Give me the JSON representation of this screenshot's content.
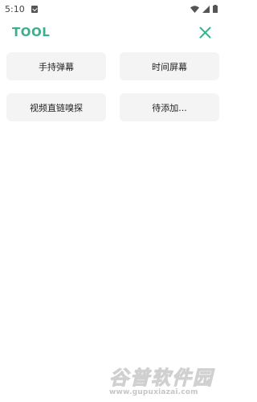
{
  "status_bar": {
    "time": "5:10",
    "icons": [
      "notification-icon",
      "wifi-icon",
      "signal-icon",
      "battery-icon"
    ]
  },
  "header": {
    "title": "TOOL",
    "close_icon": "close-icon"
  },
  "tools": [
    {
      "label": "手持弹幕"
    },
    {
      "label": "时间屏幕"
    },
    {
      "label": "视频直链嗅探"
    },
    {
      "label": "待添加..."
    }
  ],
  "watermark": {
    "logo": "谷普软件园",
    "url": "www.gupuxiazai.com"
  },
  "colors": {
    "accent": "#3fae8e",
    "button_bg": "#f4f4f4",
    "background": "#ffffff"
  }
}
